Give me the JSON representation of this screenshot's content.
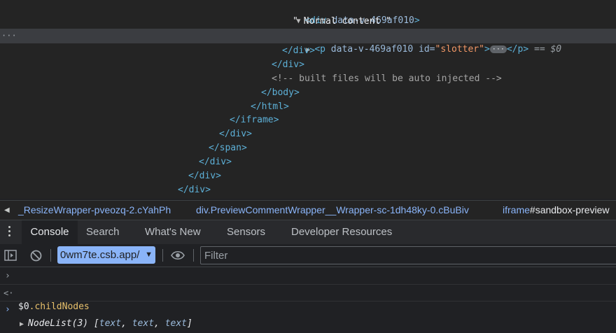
{
  "elements_tree": {
    "div_open": {
      "tag_open": "<div",
      "attr_name": "data-v-469af010",
      "tag_close": ">"
    },
    "text_node": "\" Normal content \"",
    "selected": {
      "tag_open": "<p",
      "attr1_name": "data-v-469af010",
      "attr2_name": "id=",
      "attr2_value": "\"slotter\"",
      "tag_gt": ">",
      "ellipsis": "···",
      "tag_close": "</p>",
      "eq": " == ",
      "ref": "$0",
      "gutter": "···"
    },
    "closers": {
      "div1": "</div>",
      "div2": "</div>",
      "comment": "<!-- built files will be auto injected -->",
      "body": "</body>",
      "html": "</html>",
      "iframe": "</iframe>",
      "div3": "</div>",
      "span": "</span>",
      "div4": "</div>",
      "div5": "</div>",
      "div6": "</div>"
    }
  },
  "breadcrumbs": {
    "items": [
      "_ResizeWrapper-pveozq-2.cYahPh",
      "div.PreviewCommentWrapper__Wrapper-sc-1dh48ky-0.cBuBiv",
      "iframe",
      "#sandbox-preview"
    ]
  },
  "drawer": {
    "tabs": [
      "Console",
      "Search",
      "What's New",
      "Sensors",
      "Developer Resources"
    ],
    "active_tab": "Console"
  },
  "console_toolbar": {
    "context": "0wm7te.csb.app/",
    "filter_placeholder": "Filter"
  },
  "console": {
    "input_var": "$0",
    "input_prop": ".childNodes",
    "result_label": "NodeList(3)",
    "result_open": " [",
    "items": [
      "text",
      "text",
      "text"
    ],
    "sep": ", ",
    "result_close": "]"
  },
  "icons": [
    "caret-left-icon",
    "kebab-menu-icon",
    "sidebar-toggle-icon",
    "clear-console-icon",
    "eye-icon",
    "prompt-icon",
    "result-arrow-icon",
    "expand-triangle-icon"
  ]
}
